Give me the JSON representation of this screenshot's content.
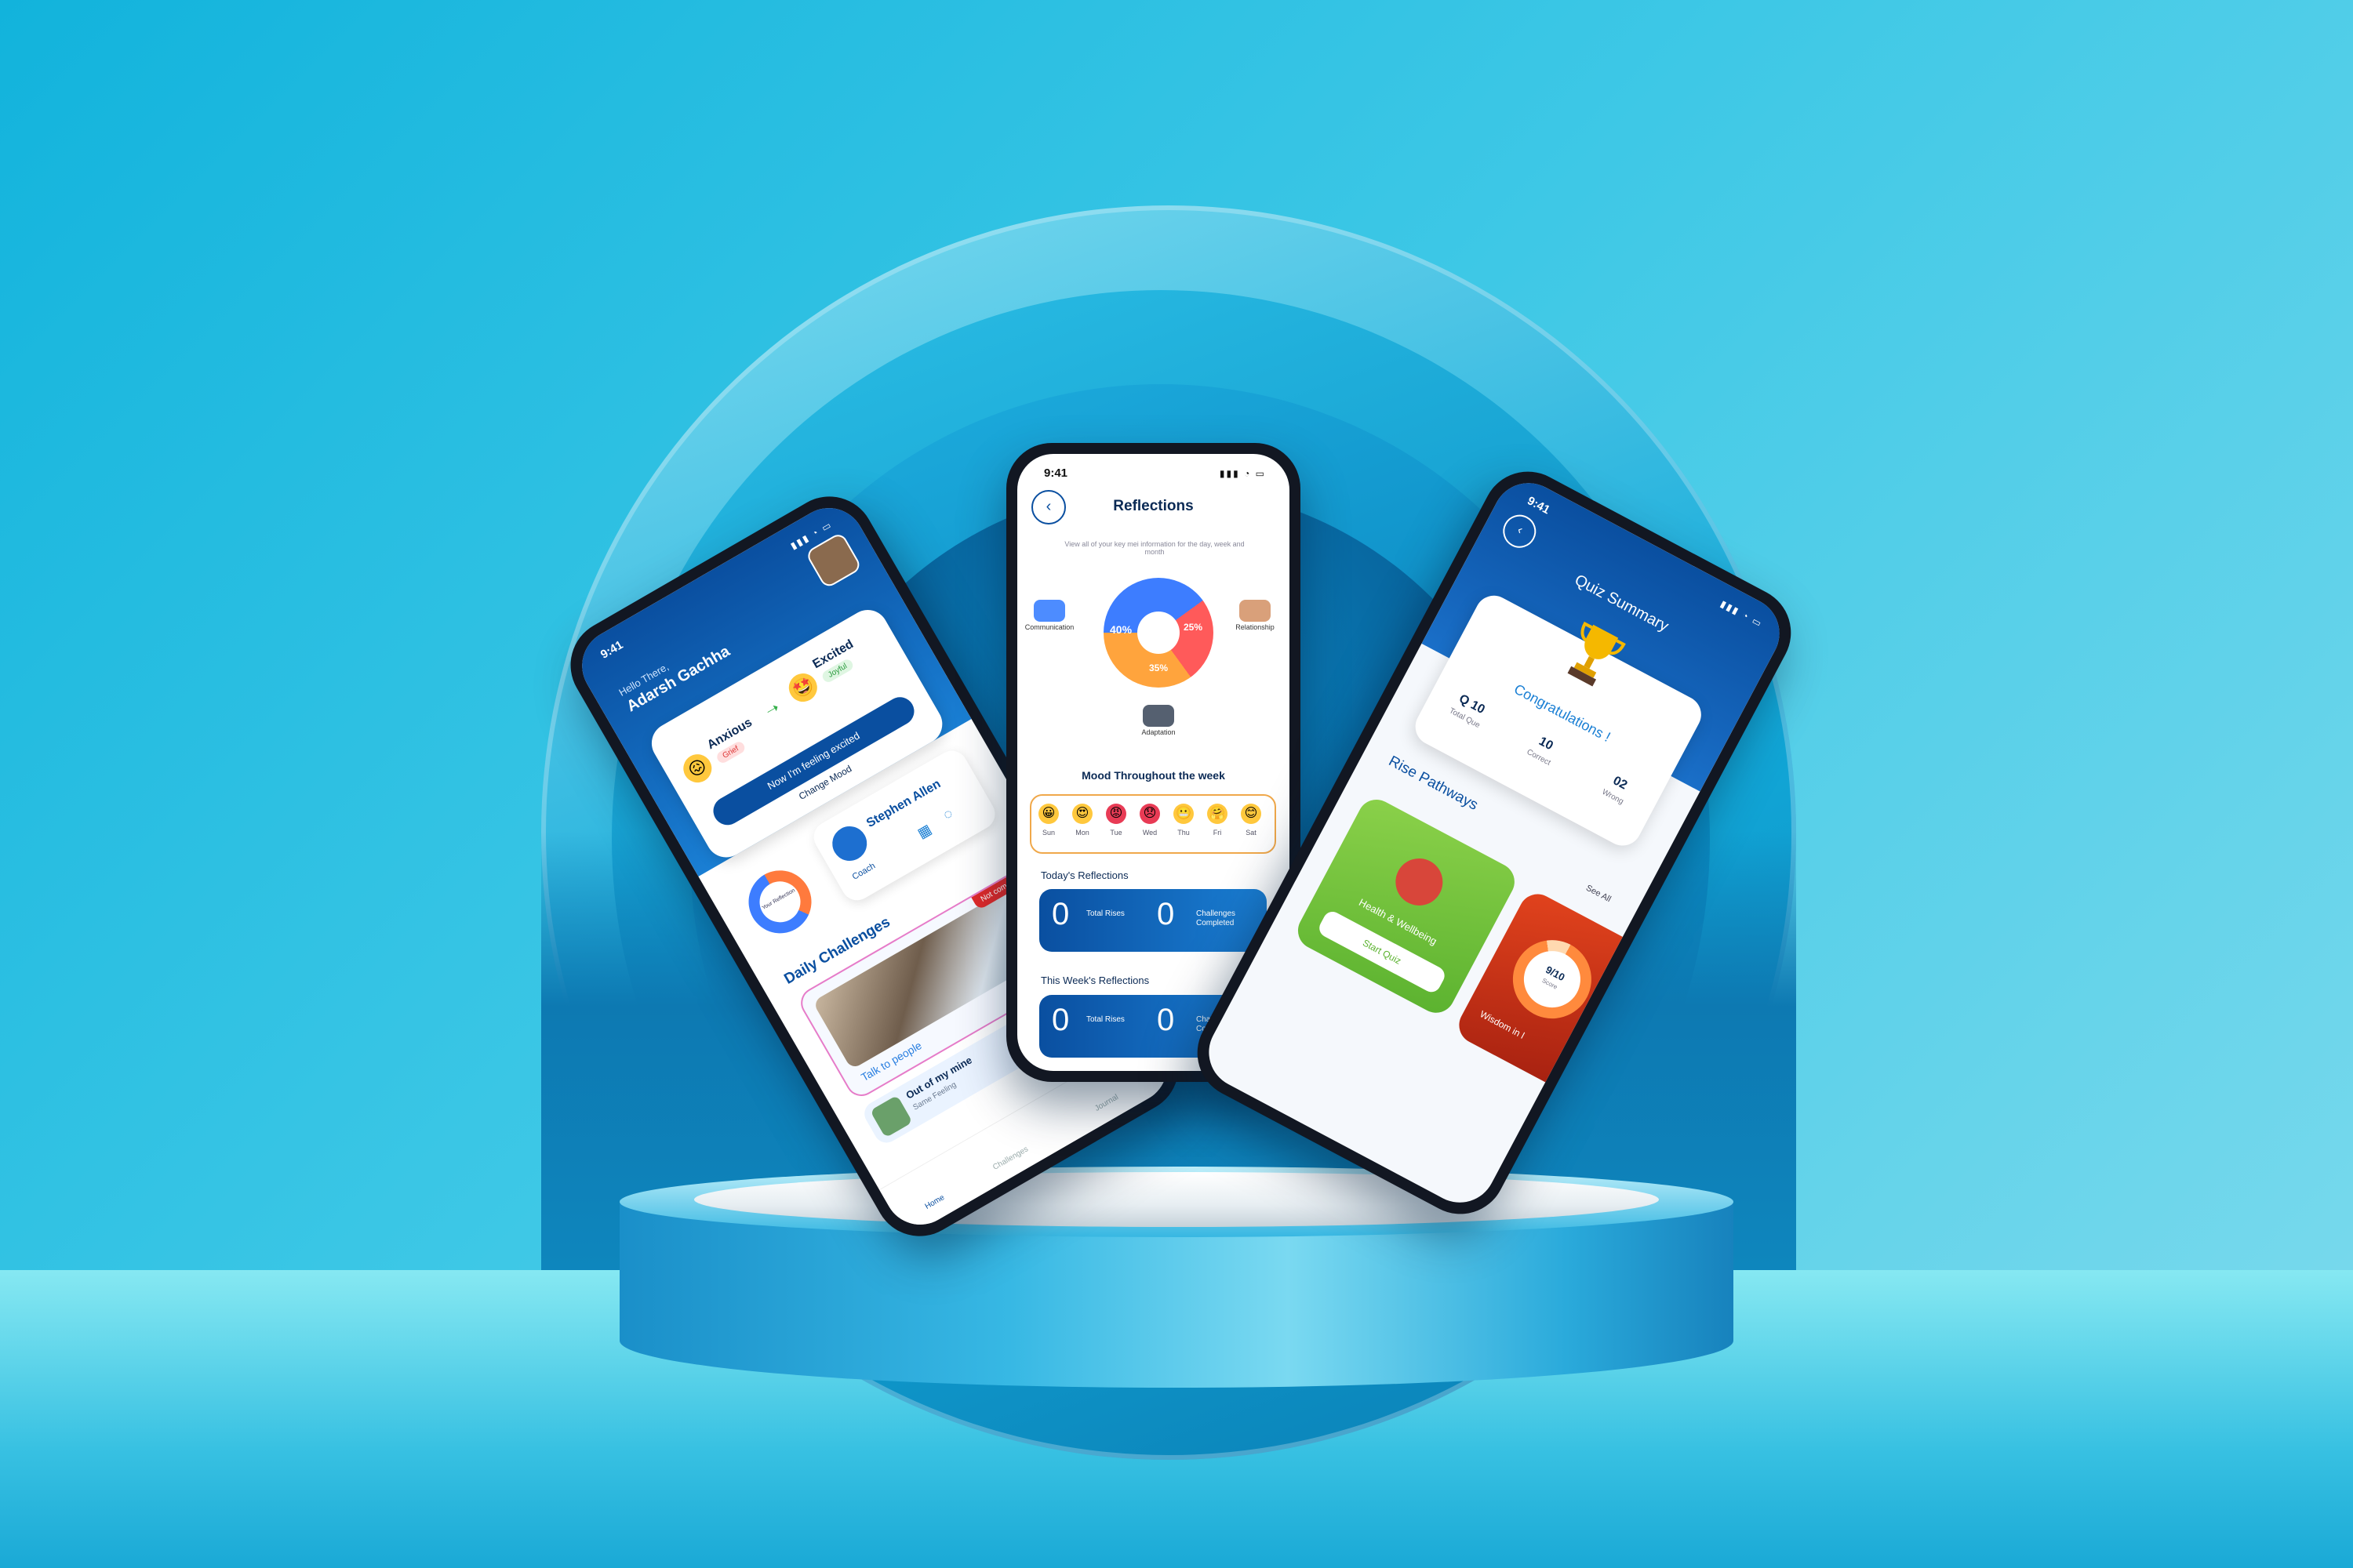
{
  "status_time": "9:41",
  "home": {
    "greeting": "Hello There,",
    "name": "Adarsh Gachha",
    "mood_from": "Anxious",
    "mood_from_tag": "Grief",
    "mood_to": "Excited",
    "mood_to_tag": "Joyful",
    "feeling_button": "Now I'm feeling excited",
    "change_mood": "Change Mood",
    "reflection_donut_label": "Your Reflection",
    "coach_name": "Stephen Allen",
    "coach_role": "Coach",
    "daily_challenges_title": "Daily Challenges",
    "challenge_status": "Not completed",
    "challenge_title": "Talk to people",
    "music_title": "Out of my mine",
    "music_sub": "Same Feeling",
    "tabs": [
      "Home",
      "Challenges",
      "Journal"
    ]
  },
  "reflections": {
    "title": "Reflections",
    "subtitle": "View all of your key mei information for the day, week and month",
    "categories": [
      "Communication",
      "Relationship",
      "Adaptation"
    ],
    "pie": [
      {
        "label": "40%",
        "value": 40,
        "color": "#3d7dff"
      },
      {
        "label": "25%",
        "value": 25,
        "color": "#ff5a5a"
      },
      {
        "label": "35%",
        "value": 35,
        "color": "#ffa43d"
      }
    ],
    "week_title": "Mood Throughout the week",
    "days": [
      "Sun",
      "Mon",
      "Tue",
      "Wed",
      "Thu",
      "Fri",
      "Sat"
    ],
    "today_title": "Today's Reflections",
    "week_section_title": "This Week's Reflections",
    "total_rises_value": "0",
    "total_rises_label": "Total Rises",
    "challenges_value": "0",
    "challenges_label": "Challenges Completed"
  },
  "quiz": {
    "title": "Quiz Summary",
    "congrats": "Congratulations !",
    "total_value": "Q 10",
    "total_label": "Total Que",
    "correct_value": "10",
    "correct_label": "Correct",
    "wrong_value": "02",
    "wrong_label": "Wrong",
    "pathways_title": "Rise Pathways",
    "see_all": "See All",
    "card1_title": "Health & Wellbeing",
    "card1_button": "Start Quiz",
    "score": "9/10",
    "score_label": "Score",
    "card2_title": "Wisdom in l"
  }
}
